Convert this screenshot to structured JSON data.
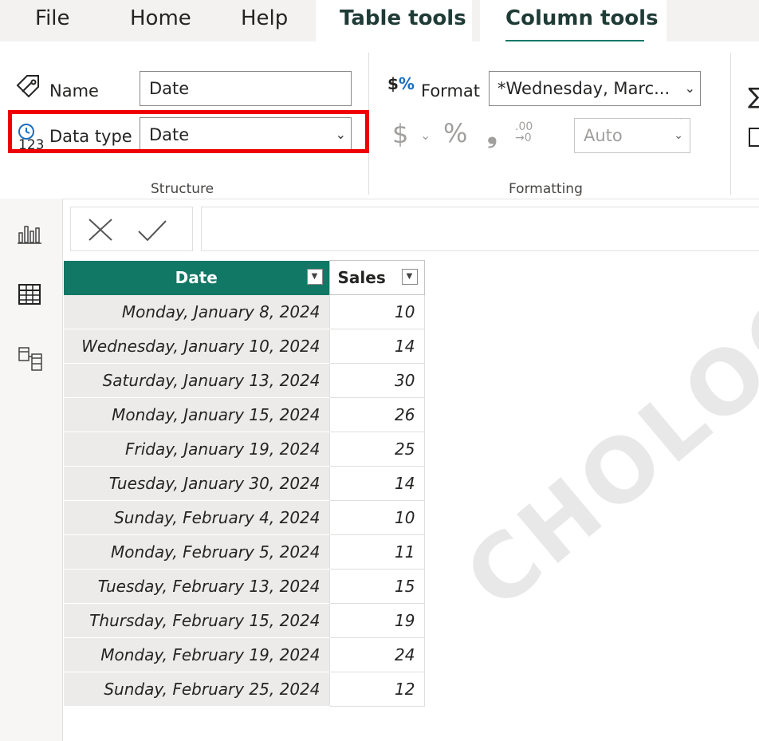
{
  "menu": {
    "file": "File",
    "home": "Home",
    "help": "Help",
    "table_tools": "Table tools",
    "column_tools": "Column tools"
  },
  "structure": {
    "name_label": "Name",
    "name_value": "Date",
    "datatype_label": "Data type",
    "datatype_value": "Date",
    "datatype_icon_text": "123",
    "group_label": "Structure"
  },
  "formatting": {
    "format_label": "Format",
    "format_value": "*Wednesday, Marc...",
    "decimal_value": "Auto",
    "currency_symbol": "$",
    "percent_symbol": "%",
    "comma_symbol": "❟",
    "group_label": "Formatting"
  },
  "table": {
    "columns": [
      "Date",
      "Sales"
    ],
    "rows": [
      [
        "Monday, January 8, 2024",
        "10"
      ],
      [
        "Wednesday, January 10, 2024",
        "14"
      ],
      [
        "Saturday, January 13, 2024",
        "30"
      ],
      [
        "Monday, January 15, 2024",
        "26"
      ],
      [
        "Friday, January 19, 2024",
        "25"
      ],
      [
        "Tuesday, January 30, 2024",
        "14"
      ],
      [
        "Sunday, February 4, 2024",
        "10"
      ],
      [
        "Monday, February 5, 2024",
        "11"
      ],
      [
        "Tuesday, February 13, 2024",
        "15"
      ],
      [
        "Thursday, February 15, 2024",
        "19"
      ],
      [
        "Monday, February 19, 2024",
        "24"
      ],
      [
        "Sunday, February 25, 2024",
        "12"
      ]
    ]
  },
  "watermark": "CHOLOGY",
  "colors": {
    "accent": "#117865",
    "highlight": "#ee0000"
  }
}
